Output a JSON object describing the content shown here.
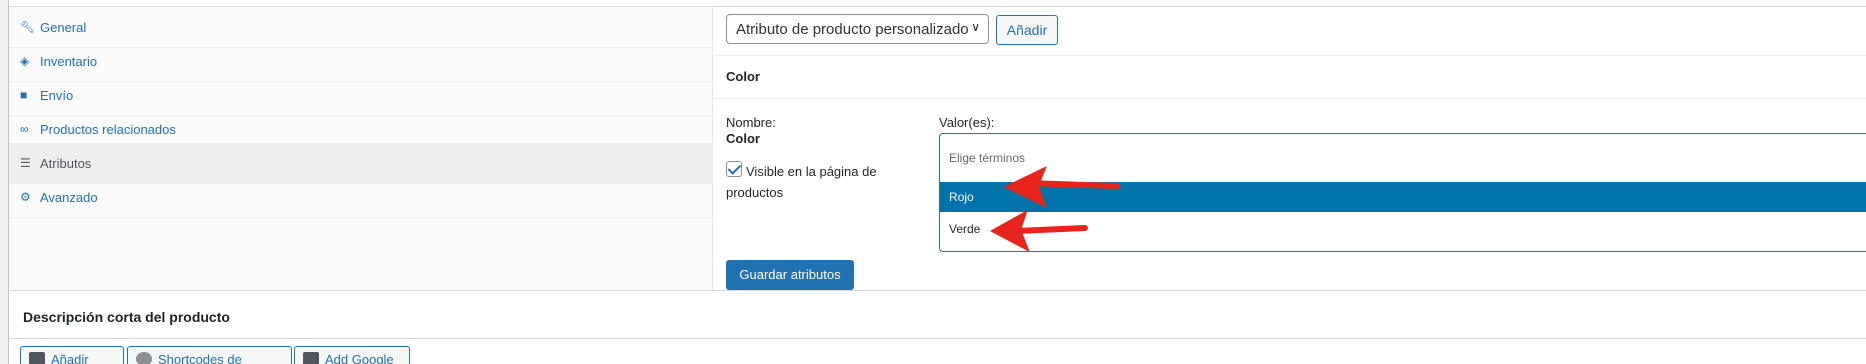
{
  "tabs": [
    {
      "label": "General",
      "icon": "wrench-icon"
    },
    {
      "label": "Inventario",
      "icon": "tag-icon"
    },
    {
      "label": "Envío",
      "icon": "truck-icon"
    },
    {
      "label": "Productos relacionados",
      "icon": "link-icon"
    },
    {
      "label": "Atributos",
      "icon": "list-icon"
    },
    {
      "label": "Avanzado",
      "icon": "gear-icon"
    }
  ],
  "active_tab": "Atributos",
  "attributes": {
    "select_value": "Atributo de producto personalizado",
    "add_label": "Añadir",
    "attribute_title": "Color",
    "name_label": "Nombre:",
    "name_value": "Color",
    "visible_label": "Visible en la página de productos",
    "visible_checked": true,
    "values_label": "Valor(es):",
    "terms_placeholder": "Elige términos",
    "options": [
      "Rojo",
      "Verde"
    ],
    "highlighted_option": "Rojo",
    "save_label": "Guardar atributos"
  },
  "short_description": {
    "title": "Descripción corta del producto",
    "toolbar": [
      "Añadir objeto",
      "Shortcodes de GiveWP",
      "Add Google File"
    ]
  },
  "colors": {
    "accent": "#2271b1",
    "highlight": "#0073aa",
    "arrow": "#e8251d"
  }
}
